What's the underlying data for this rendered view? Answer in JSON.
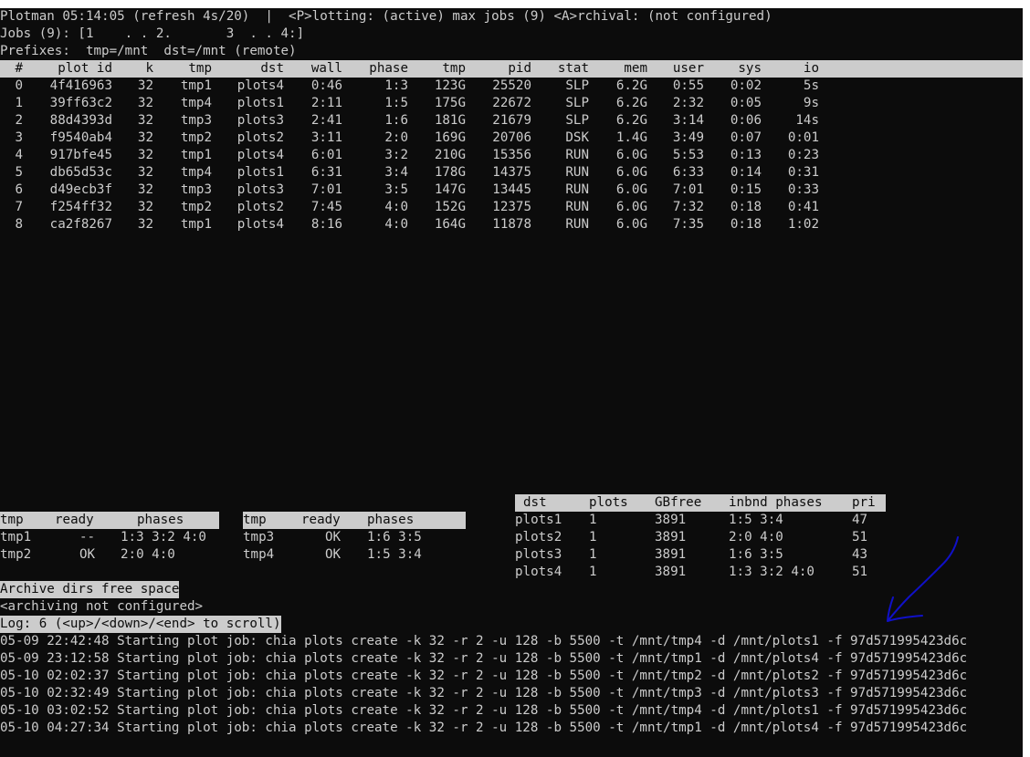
{
  "status": {
    "line1": "Plotman 05:14:05 (refresh 4s/20)  |  <P>lotting: (active) max jobs (9) <A>rchival: (not configured)",
    "line2": "Jobs (9): [1    . . 2.       3  . . 4:]",
    "line3": "Prefixes:  tmp=/mnt  dst=/mnt (remote)"
  },
  "jobs_table": {
    "headers": [
      "#",
      "plot id",
      "k",
      "tmp",
      "dst",
      "wall",
      "phase",
      "tmp",
      "pid",
      "stat",
      "mem",
      "user",
      "sys",
      "io"
    ],
    "rows": [
      [
        "0",
        "4f416963",
        "32",
        "tmp1",
        "plots4",
        "0:46",
        "1:3",
        "123G",
        "25520",
        "SLP",
        "6.2G",
        "0:55",
        "0:02",
        "5s"
      ],
      [
        "1",
        "39ff63c2",
        "32",
        "tmp4",
        "plots1",
        "2:11",
        "1:5",
        "175G",
        "22672",
        "SLP",
        "6.2G",
        "2:32",
        "0:05",
        "9s"
      ],
      [
        "2",
        "88d4393d",
        "32",
        "tmp3",
        "plots3",
        "2:41",
        "1:6",
        "181G",
        "21679",
        "SLP",
        "6.2G",
        "3:14",
        "0:06",
        "14s"
      ],
      [
        "3",
        "f9540ab4",
        "32",
        "tmp2",
        "plots2",
        "3:11",
        "2:0",
        "169G",
        "20706",
        "DSK",
        "1.4G",
        "3:49",
        "0:07",
        "0:01"
      ],
      [
        "4",
        "917bfe45",
        "32",
        "tmp1",
        "plots4",
        "6:01",
        "3:2",
        "210G",
        "15356",
        "RUN",
        "6.0G",
        "5:53",
        "0:13",
        "0:23"
      ],
      [
        "5",
        "db65d53c",
        "32",
        "tmp4",
        "plots1",
        "6:31",
        "3:4",
        "178G",
        "14375",
        "RUN",
        "6.0G",
        "6:33",
        "0:14",
        "0:31"
      ],
      [
        "6",
        "d49ecb3f",
        "32",
        "tmp3",
        "plots3",
        "7:01",
        "3:5",
        "147G",
        "13445",
        "RUN",
        "6.0G",
        "7:01",
        "0:15",
        "0:33"
      ],
      [
        "7",
        "f254ff32",
        "32",
        "tmp2",
        "plots2",
        "7:45",
        "4:0",
        "152G",
        "12375",
        "RUN",
        "6.0G",
        "7:32",
        "0:18",
        "0:41"
      ],
      [
        "8",
        "ca2f8267",
        "32",
        "tmp1",
        "plots4",
        "8:16",
        "4:0",
        "164G",
        "11878",
        "RUN",
        "6.0G",
        "7:35",
        "0:18",
        "1:02"
      ]
    ]
  },
  "tmp_table_left": {
    "headers": [
      "tmp",
      "ready",
      "phases"
    ],
    "rows": [
      [
        "tmp1",
        "--",
        "1:3 3:2 4:0"
      ],
      [
        "tmp2",
        "OK",
        "2:0 4:0"
      ]
    ]
  },
  "tmp_table_right": {
    "headers": [
      "tmp",
      "ready",
      "phases"
    ],
    "rows": [
      [
        "tmp3",
        "OK",
        "1:6 3:5"
      ],
      [
        "tmp4",
        "OK",
        "1:5 3:4"
      ]
    ]
  },
  "dst_table": {
    "headers": [
      "dst",
      "plots",
      "GBfree",
      "inbnd phases",
      "pri"
    ],
    "rows": [
      [
        "plots1",
        "1",
        "3891",
        "1:5 3:4",
        "47"
      ],
      [
        "plots2",
        "1",
        "3891",
        "2:0 4:0",
        "51"
      ],
      [
        "plots3",
        "1",
        "3891",
        "1:6 3:5",
        "43"
      ],
      [
        "plots4",
        "1",
        "3891",
        "1:3 3:2 4:0",
        "51"
      ]
    ]
  },
  "archive": {
    "title": "Archive dirs free space",
    "status": "<archiving not configured>"
  },
  "log": {
    "header": "Log: 6 (<up>/<down>/<end> to scroll)",
    "lines": [
      "05-09 22:42:48 Starting plot job: chia plots create -k 32 -r 2 -u 128 -b 5500 -t /mnt/tmp4 -d /mnt/plots1 -f 97d571995423d6c",
      "05-09 23:12:58 Starting plot job: chia plots create -k 32 -r 2 -u 128 -b 5500 -t /mnt/tmp1 -d /mnt/plots4 -f 97d571995423d6c",
      "05-10 02:02:37 Starting plot job: chia plots create -k 32 -r 2 -u 128 -b 5500 -t /mnt/tmp2 -d /mnt/plots2 -f 97d571995423d6c",
      "05-10 02:32:49 Starting plot job: chia plots create -k 32 -r 2 -u 128 -b 5500 -t /mnt/tmp3 -d /mnt/plots3 -f 97d571995423d6c",
      "05-10 03:02:52 Starting plot job: chia plots create -k 32 -r 2 -u 128 -b 5500 -t /mnt/tmp4 -d /mnt/plots1 -f 97d571995423d6c",
      "05-10 04:27:34 Starting plot job: chia plots create -k 32 -r 2 -u 128 -b 5500 -t /mnt/tmp1 -d /mnt/plots4 -f 97d571995423d6c"
    ]
  },
  "colors": {
    "terminal_bg": "#0c0c0c",
    "terminal_fg": "#cccccc",
    "annotation_arrow": "#1010c8"
  }
}
